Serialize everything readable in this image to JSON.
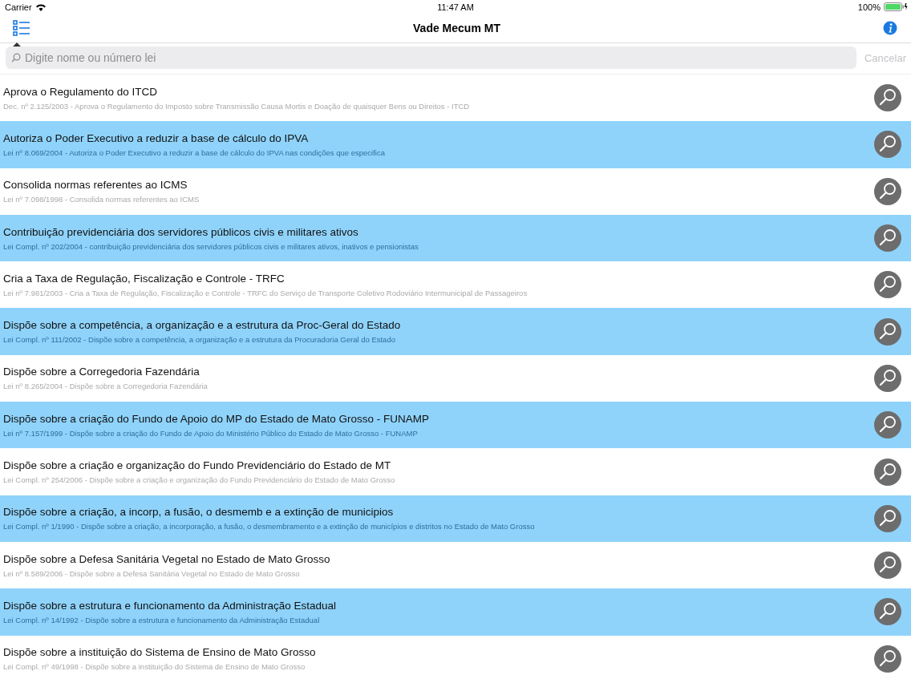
{
  "status_bar": {
    "carrier": "Carrier",
    "time": "11:47 AM",
    "battery": "100%"
  },
  "nav_bar": {
    "title": "Vade Mecum MT"
  },
  "search": {
    "placeholder": "Digite nome ou número lei",
    "cancel": "Cancelar"
  },
  "laws": [
    {
      "title": "Aprova o Regulamento do ITCD",
      "subtitle": "Dec. nº 2.125/2003 - Aprova o Regulamento do Imposto sobre Transmissão Causa Mortis e Doação de quaisquer Bens ou Direitos - ITCD"
    },
    {
      "title": "Autoriza o Poder Executivo a reduzir a base de cálculo do IPVA",
      "subtitle": "Lei nº 8.069/2004 - Autoriza o Poder Executivo a reduzir a base de cálculo do IPVA nas condições que especifica"
    },
    {
      "title": "Consolida normas referentes ao ICMS",
      "subtitle": "Lei nº 7.098/1998 - Consolida normas referentes ao ICMS"
    },
    {
      "title": "Contribuição previdenciária dos servidores públicos civis e militares ativos",
      "subtitle": "Lei Compl. nº 202/2004 - contribuição previdenciária dos servidores públicos civis e militares ativos, inativos e pensionistas"
    },
    {
      "title": "Cria a Taxa de Regulação, Fiscalização e Controle - TRFC",
      "subtitle": "Lei nº 7.981/2003 - Cria a Taxa de Regulação, Fiscalização e Controle - TRFC do Serviço de Transporte Coletivo Rodoviário Intermunicipal de Passageiros"
    },
    {
      "title": "Dispõe sobre a competência, a organização e a estrutura da Proc-Geral do Estado",
      "subtitle": "Lei Compl. nº 111/2002 - Dispõe sobre a competência, a organização e a estrutura da Procuradoria Geral do Estado"
    },
    {
      "title": "Dispõe sobre a Corregedoria Fazendária",
      "subtitle": "Lei nº 8.265/2004 - Dispõe sobre a Corregedoria Fazendária"
    },
    {
      "title": "Dispõe sobre a criação do Fundo de Apoio do MP do Estado de Mato Grosso - FUNAMP",
      "subtitle": "Lei nº 7.157/1999 - Dispõe sobre a criação do Fundo de Apoio do Ministério Público do Estado de Mato Grosso - FUNAMP"
    },
    {
      "title": "Dispõe sobre a criação e organização do Fundo Previdenciário do Estado de MT",
      "subtitle": "Lei Compl. nº 254/2006 - Dispõe sobre a criação e organização do Fundo Previdenciário do Estado de Mato Grosso"
    },
    {
      "title": "Dispõe sobre a criação, a incorp, a fusão, o desmemb e a extinção de municipios",
      "subtitle": "Lei Compl. nº 1/1990 - Dispõe sobre a criação, a incorporação, a fusão, o desmembramento e a extinção de municípios e distritos no Estado de Mato Grosso"
    },
    {
      "title": "Dispõe sobre a Defesa Sanitária Vegetal no Estado de Mato Grosso",
      "subtitle": "Lei nº 8.589/2006 - Dispõe sobre a Defesa Sanitária Vegetal no Estado de Mato Grosso"
    },
    {
      "title": "Dispõe sobre a estrutura e funcionamento da Administração Estadual",
      "subtitle": "Lei Compl. nº 14/1992 - Dispõe sobre a estrutura e funcionamento da Administração Estadual"
    },
    {
      "title": "Dispõe sobre a instituição do Sistema de Ensino de Mato Grosso",
      "subtitle": "Lei Compl. nº 49/1998 - Dispõe sobre a instituição do Sistema de Ensino de Mato Grosso"
    }
  ]
}
